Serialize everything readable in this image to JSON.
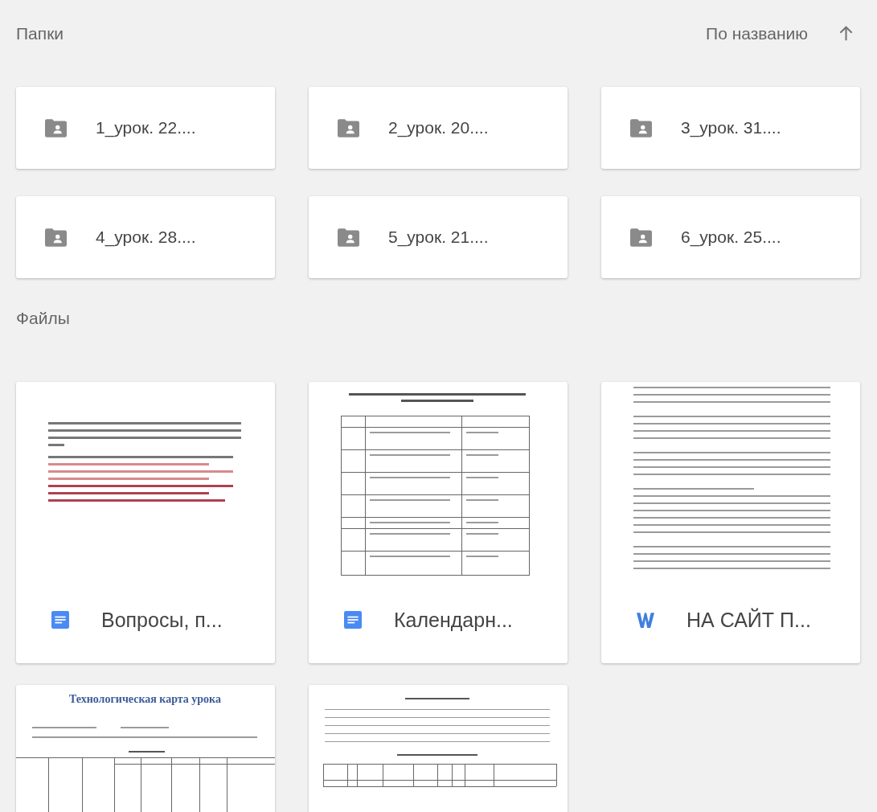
{
  "folders_section": {
    "title": "Папки"
  },
  "sort": {
    "label": "По названию"
  },
  "folders": [
    {
      "name": "1_урок. 22...."
    },
    {
      "name": "2_урок. 20...."
    },
    {
      "name": "3_урок. 31...."
    },
    {
      "name": "4_урок. 28...."
    },
    {
      "name": "5_урок. 21...."
    },
    {
      "name": "6_урок. 25...."
    }
  ],
  "files_section": {
    "title": "Файлы"
  },
  "files": [
    {
      "name": "Вопросы, п...",
      "kind": "gdoc"
    },
    {
      "name": "Календарн...",
      "kind": "gdoc"
    },
    {
      "name": "НА САЙТ П...",
      "kind": "word"
    },
    {
      "kind": "cut",
      "preview_title": "Технологическая карта урока"
    },
    {
      "kind": "cut"
    }
  ]
}
